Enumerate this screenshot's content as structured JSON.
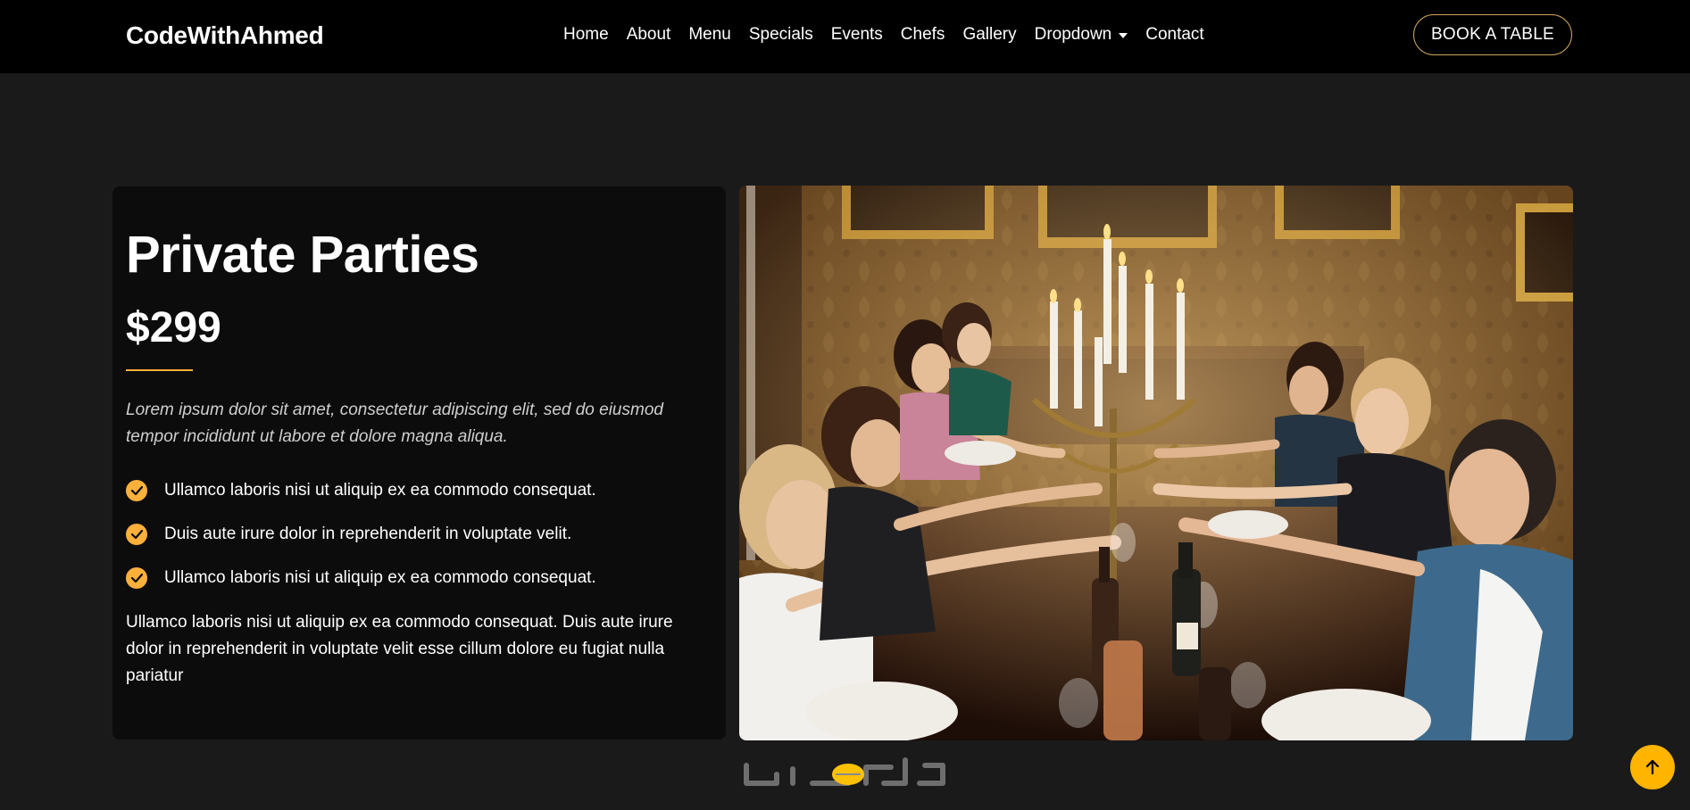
{
  "header": {
    "brand": "CodeWithAhmed",
    "nav": [
      {
        "label": "Home"
      },
      {
        "label": "About"
      },
      {
        "label": "Menu"
      },
      {
        "label": "Specials"
      },
      {
        "label": "Events"
      },
      {
        "label": "Chefs"
      },
      {
        "label": "Gallery"
      },
      {
        "label": "Dropdown"
      },
      {
        "label": "Contact"
      }
    ],
    "book_label": "BOOK A TABLE"
  },
  "event": {
    "title": "Private Parties",
    "price": "$299",
    "lead": "Lorem ipsum dolor sit amet, consectetur adipiscing elit, sed do eiusmod tempor incididunt ut labore et dolore magna aliqua.",
    "checks": [
      "Ullamco laboris nisi ut aliquip ex ea commodo consequat.",
      "Duis aute irure dolor in reprehenderit in voluptate velit.",
      "Ullamco laboris nisi ut aliquip ex ea commodo consequat."
    ],
    "body": "Ullamco laboris nisi ut aliquip ex ea commodo consequat. Duis aute irure dolor in reprehenderit in voluptate velit esse cillum dolore eu fugiat nulla pariatur"
  },
  "icons": {
    "check": "check-circle-icon",
    "to_top": "arrow-up-icon",
    "dropdown": "chevron-down-icon"
  },
  "colors": {
    "accent": "#ffb03b",
    "button_border": "#cda45e",
    "background": "#1a1a1b",
    "header": "#000000",
    "card": "#0c0c0c"
  }
}
